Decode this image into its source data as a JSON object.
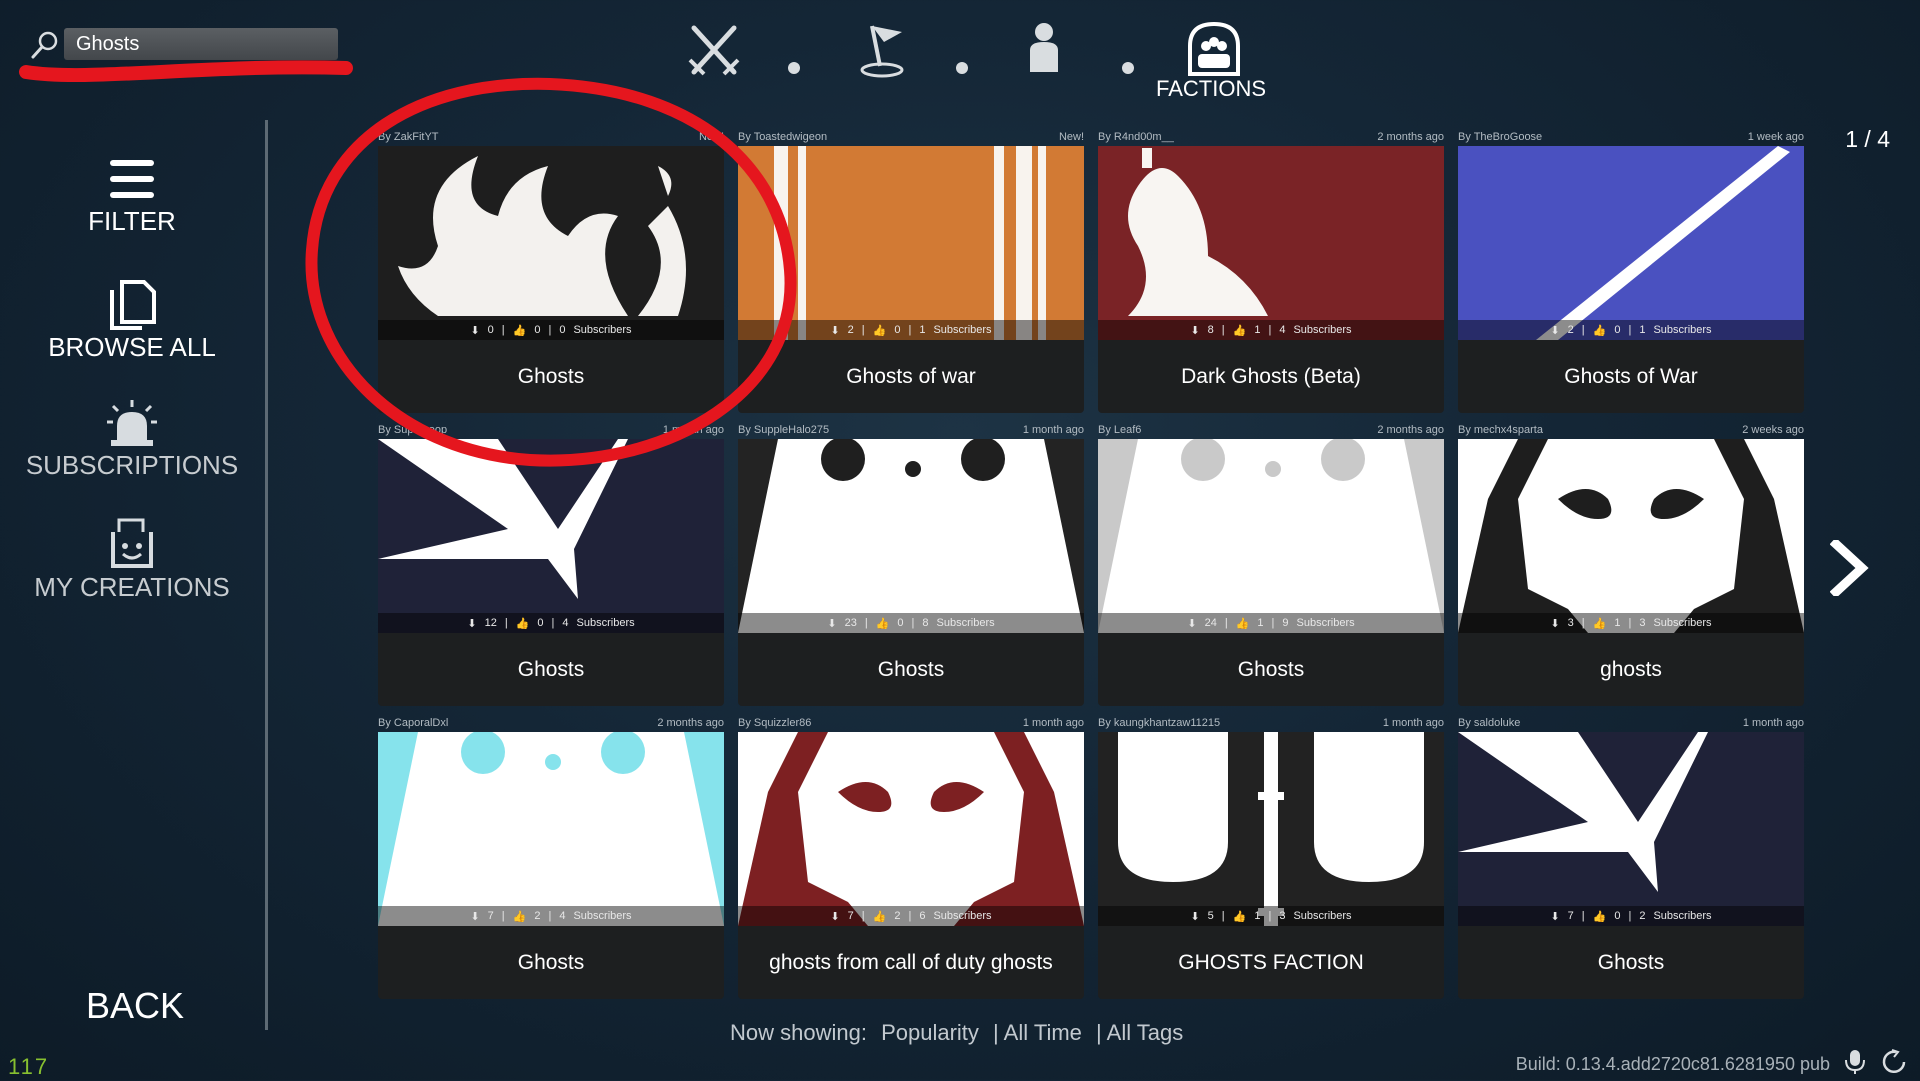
{
  "search": {
    "value": "Ghosts"
  },
  "topnav": {
    "active_label": "FACTIONS"
  },
  "sidebar": {
    "filter": "FILTER",
    "browse_all": "BROWSE ALL",
    "subscriptions": "SUBSCRIPTIONS",
    "my_creations": "MY CREATIONS",
    "back": "BACK"
  },
  "page_indicator": "1 / 4",
  "stats_label": "Subscribers",
  "cards": [
    {
      "author": "By ZakFitYT",
      "age": "New!",
      "downloads": "0",
      "likes": "0",
      "subscribers": "0",
      "title": "Ghosts"
    },
    {
      "author": "By Toastedwigeon",
      "age": "New!",
      "downloads": "2",
      "likes": "0",
      "subscribers": "1",
      "title": "Ghosts of war"
    },
    {
      "author": "By R4nd00m__",
      "age": "2 months ago",
      "downloads": "8",
      "likes": "1",
      "subscribers": "4",
      "title": "Dark Ghosts (Beta)"
    },
    {
      "author": "By TheBroGoose",
      "age": "1 week ago",
      "downloads": "2",
      "likes": "0",
      "subscribers": "1",
      "title": "Ghosts of War"
    },
    {
      "author": "By Supercoop",
      "age": "1 month ago",
      "downloads": "12",
      "likes": "0",
      "subscribers": "4",
      "title": "Ghosts"
    },
    {
      "author": "By SuppleHalo275",
      "age": "1 month ago",
      "downloads": "23",
      "likes": "0",
      "subscribers": "8",
      "title": "Ghosts"
    },
    {
      "author": "By Leaf6",
      "age": "2 months ago",
      "downloads": "24",
      "likes": "1",
      "subscribers": "9",
      "title": "Ghosts"
    },
    {
      "author": "By mechx4sparta",
      "age": "2 weeks ago",
      "downloads": "3",
      "likes": "1",
      "subscribers": "3",
      "title": "ghosts"
    },
    {
      "author": "By CaporalDxl",
      "age": "2 months ago",
      "downloads": "7",
      "likes": "2",
      "subscribers": "4",
      "title": "Ghosts"
    },
    {
      "author": "By Squizzler86",
      "age": "1 month ago",
      "downloads": "7",
      "likes": "2",
      "subscribers": "6",
      "title": "ghosts from call of duty ghosts"
    },
    {
      "author": "By kaungkhantzaw11215",
      "age": "1 month ago",
      "downloads": "5",
      "likes": "1",
      "subscribers": "3",
      "title": "GHOSTS FACTION"
    },
    {
      "author": "By saldoluke",
      "age": "1 month ago",
      "downloads": "7",
      "likes": "0",
      "subscribers": "2",
      "title": "Ghosts"
    }
  ],
  "now_showing": {
    "prefix": "Now showing:",
    "sort": "Popularity",
    "time": "| All Time",
    "tags": "| All Tags"
  },
  "build": "Build: 0.13.4.add2720c81.6281950 pub",
  "fps": "117",
  "colors": {
    "annotation_red": "#e5161e",
    "card_bar": "#1d1f20"
  }
}
